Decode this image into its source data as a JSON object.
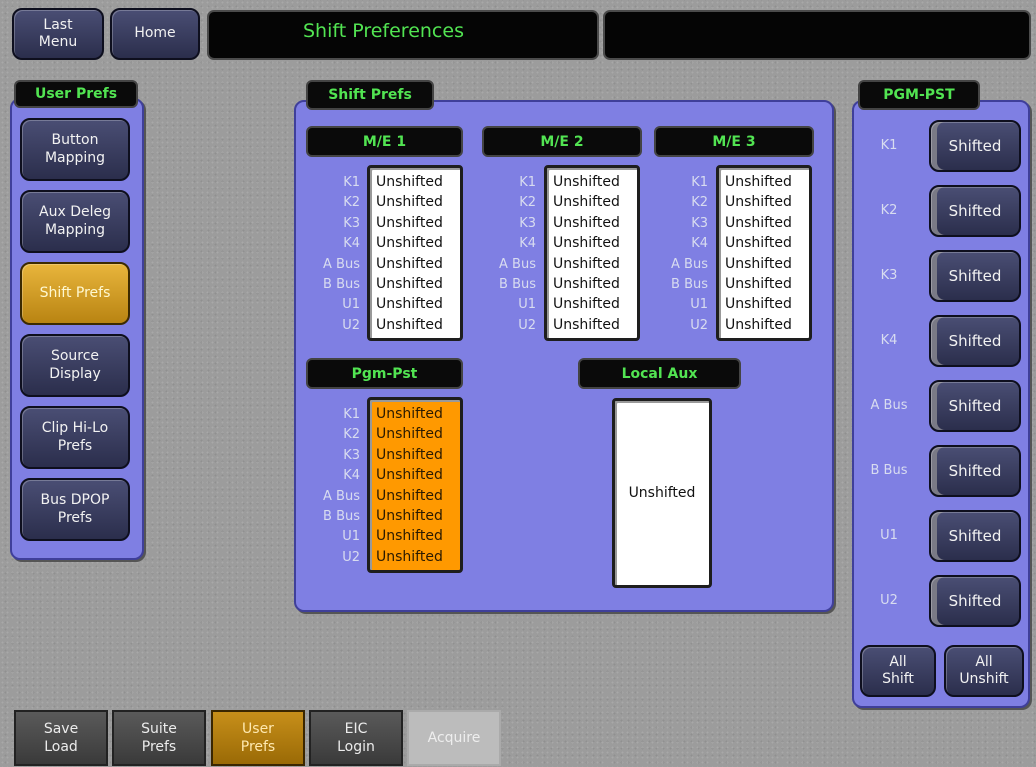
{
  "header": {
    "last_menu": "Last\nMenu",
    "home": "Home",
    "title": "Shift Preferences"
  },
  "sidebar": {
    "title": "User Prefs",
    "items": [
      {
        "label": "Button\nMapping"
      },
      {
        "label": "Aux Deleg\nMapping"
      },
      {
        "label": "Shift Prefs",
        "active": true
      },
      {
        "label": "Source\nDisplay"
      },
      {
        "label": "Clip Hi-Lo\nPrefs"
      },
      {
        "label": "Bus DPOP\nPrefs"
      }
    ]
  },
  "shift_prefs": {
    "title": "Shift Prefs",
    "key_labels": [
      "K1",
      "K2",
      "K3",
      "K4",
      "A Bus",
      "B Bus",
      "U1",
      "U2"
    ],
    "me1": {
      "title": "M/E 1",
      "values": [
        "Unshifted",
        "Unshifted",
        "Unshifted",
        "Unshifted",
        "Unshifted",
        "Unshifted",
        "Unshifted",
        "Unshifted"
      ]
    },
    "me2": {
      "title": "M/E 2",
      "values": [
        "Unshifted",
        "Unshifted",
        "Unshifted",
        "Unshifted",
        "Unshifted",
        "Unshifted",
        "Unshifted",
        "Unshifted"
      ]
    },
    "me3": {
      "title": "M/E 3",
      "values": [
        "Unshifted",
        "Unshifted",
        "Unshifted",
        "Unshifted",
        "Unshifted",
        "Unshifted",
        "Unshifted",
        "Unshifted"
      ]
    },
    "pgm_pst": {
      "title": "Pgm-Pst",
      "values": [
        "Unshifted",
        "Unshifted",
        "Unshifted",
        "Unshifted",
        "Unshifted",
        "Unshifted",
        "Unshifted",
        "Unshifted"
      ]
    },
    "local_aux": {
      "title": "Local Aux",
      "value": "Unshifted"
    }
  },
  "pgm_pst_panel": {
    "title": "PGM-PST",
    "rows": [
      {
        "label": "K1",
        "state": "Shifted"
      },
      {
        "label": "K2",
        "state": "Shifted"
      },
      {
        "label": "K3",
        "state": "Shifted"
      },
      {
        "label": "K4",
        "state": "Shifted"
      },
      {
        "label": "A Bus",
        "state": "Shifted"
      },
      {
        "label": "B Bus",
        "state": "Shifted"
      },
      {
        "label": "U1",
        "state": "Shifted"
      },
      {
        "label": "U2",
        "state": "Shifted"
      }
    ],
    "all_shift": "All\nShift",
    "all_unshift": "All\nUnshift"
  },
  "bottom_nav": [
    {
      "label": "Save\nLoad"
    },
    {
      "label": "Suite\nPrefs"
    },
    {
      "label": "User\nPrefs",
      "active": true
    },
    {
      "label": "EIC\nLogin"
    },
    {
      "label": "Acquire",
      "disabled": true
    }
  ],
  "colors": {
    "accent_text": "#52e452",
    "panel": "#7f7fe3",
    "active": "#e8b53c",
    "highlight_list": "#ff9900"
  }
}
